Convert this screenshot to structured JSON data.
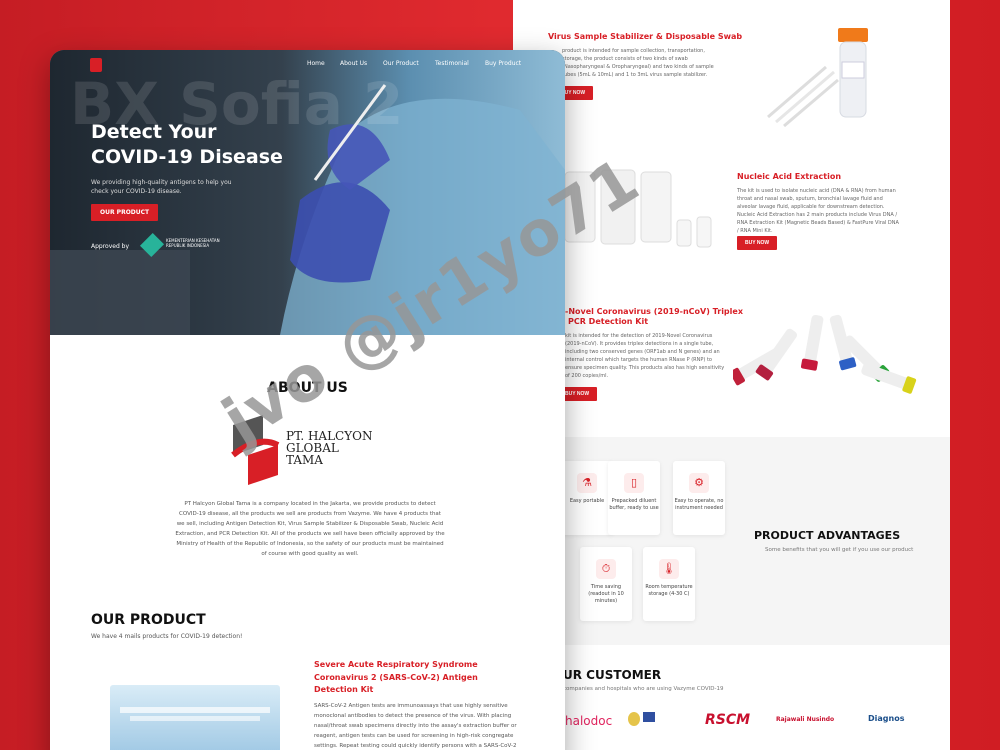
{
  "back": {
    "swab": {
      "title": "Virus Sample Stabilizer & Disposable Swab",
      "text": "product is intended for sample collection, transportation, storage, the product consists of two kinds of swab (Nasopharyngeal & Oropharyngeal) and two kinds of sample tubes (5mL & 10mL) and 1 to 3mL virus sample stabilizer.",
      "button": "BUY NOW"
    },
    "nucleic": {
      "title": "Nucleic Acid Extraction",
      "text": "The kit is used to isolate nucleic acid (DNA & RNA) from human throat and nasal swab, sputum, bronchial lavage fluid and alveolar lavage fluid, applicable for downstream detection. Nucleic Acid Extraction has 2 main products include Virus DNA / RNA Extraction Kit (Magnetic Beads Based) & FastPure Viral DNA / RNA Mini Kit.",
      "button": "BUY NOW"
    },
    "pcr": {
      "title1": "-Novel Coronavirus (2019-nCoV) Triplex",
      "title2": "PCR Detection Kit",
      "text": "kit is intended for the detection of 2019-Novel Coronavirus (2019-nCoV). It provides triplex detections in a single tube, including two conserved genes (ORF1ab and N genes) and an internal control which targets the human RNase P (RNP) to ensure specimen quality. This products also has high sensitivity of 200 copies/ml.",
      "button": "BUY NOW"
    },
    "advantages": {
      "title": "PRODUCT ADVANTAGES",
      "subtitle": "Some benefits that you will get if you use our product",
      "cards": [
        {
          "icon": "flask-icon",
          "glyph": "⚗",
          "text": "Easy portable"
        },
        {
          "icon": "buffer-icon",
          "glyph": "▯",
          "text": "Prepacked diluent buffer, ready to use"
        },
        {
          "icon": "gear-icon",
          "glyph": "⚙",
          "text": "Easy to operate, no instrument needed"
        },
        {
          "icon": "timer-icon",
          "glyph": "⏱",
          "text": "Time saving (readout in 10 minutes)"
        },
        {
          "icon": "thermometer-icon",
          "glyph": "🌡",
          "text": "Room temperature storage (4-30 C)"
        }
      ]
    },
    "customer": {
      "title": "UR CUSTOMER",
      "subtitle": "companies and hospitals who are using Vazyme COVID-19",
      "logos": [
        "halodoc",
        "RSCM",
        "Rajawali Nusindo",
        "Diagnos"
      ]
    }
  },
  "front": {
    "nav": [
      "Home",
      "About Us",
      "Our Product",
      "Testimonial",
      "Buy Product"
    ],
    "hero": {
      "title_line1": "Detect Your",
      "title_line2": "COVID-19 Disease",
      "subtitle": "We providing high-quality antigens to help you check your COVID-19 disease.",
      "cta": "OUR PRODUCT",
      "approved": "Approved by",
      "approver": "KEMENTERIAN KESEHATAN REPUBLIK INDONESIA",
      "bg_text": "BX Sofia 2"
    },
    "about": {
      "title": "ABOUT US",
      "logo_line1": "PT. HALCYON",
      "logo_line2": "GLOBAL",
      "logo_line3": "TAMA",
      "text": "PT Halcyon Global Tama is a company located in the Jakarta, we provide products to detect COVID-19 disease, all the products we sell are products from Vazyme. We have 4 products that we sell, including Antigen Detection Kit, Virus Sample Stabilizer & Disposable Swab, Nucleic Acid Extraction, and PCR Detection Kit. All of the products we sell have been officially approved by the Ministry of Health of the Republic of Indonesia, so the safety of our products must be maintained of course with good quality as well."
    },
    "products": {
      "title": "OUR PRODUCT",
      "subtitle": "We have 4 mails products for COVID-19 detection!",
      "sars_title": "Severe Acute Respiratory Syndrome Coronavirus 2 (SARS-CoV-2) Antigen Detection Kit",
      "sars_text": "SARS-CoV-2 Antigen tests are immunoassays that use highly sensitive monoclonal antibodies to detect the presence of the virus. With placing nasal/throat swab specimens directly into the assay's extraction buffer or reagent, antigen tests can be used for screening in high-risk congregate settings. Repeat testing could quickly identify persons with a SARS-CoV-2"
    }
  },
  "watermark": "jvo @jr1yo71",
  "colors": {
    "accent": "#d81f26",
    "bg": "#d81f26"
  }
}
